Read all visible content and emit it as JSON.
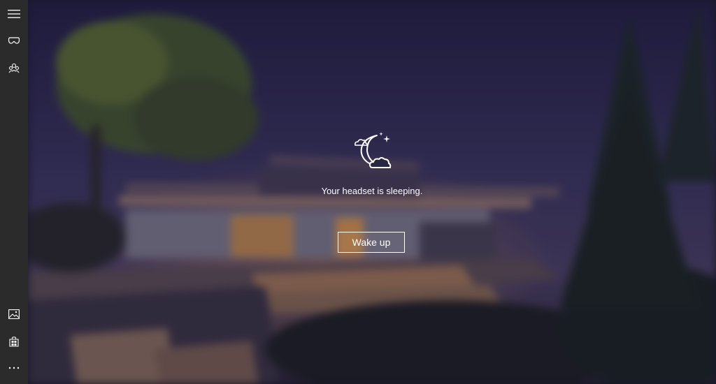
{
  "sidebar": {
    "items": [
      {
        "icon": "hamburger-menu-icon"
      },
      {
        "icon": "mixed-reality-headset-icon"
      },
      {
        "icon": "people-icon"
      },
      {
        "icon": "image-icon"
      },
      {
        "icon": "store-icon"
      },
      {
        "icon": "more-icon"
      }
    ]
  },
  "main": {
    "status_text": "Your headset is sleeping.",
    "wake_button_label": "Wake up",
    "sleep_icon": "moon-cloud-icon"
  }
}
